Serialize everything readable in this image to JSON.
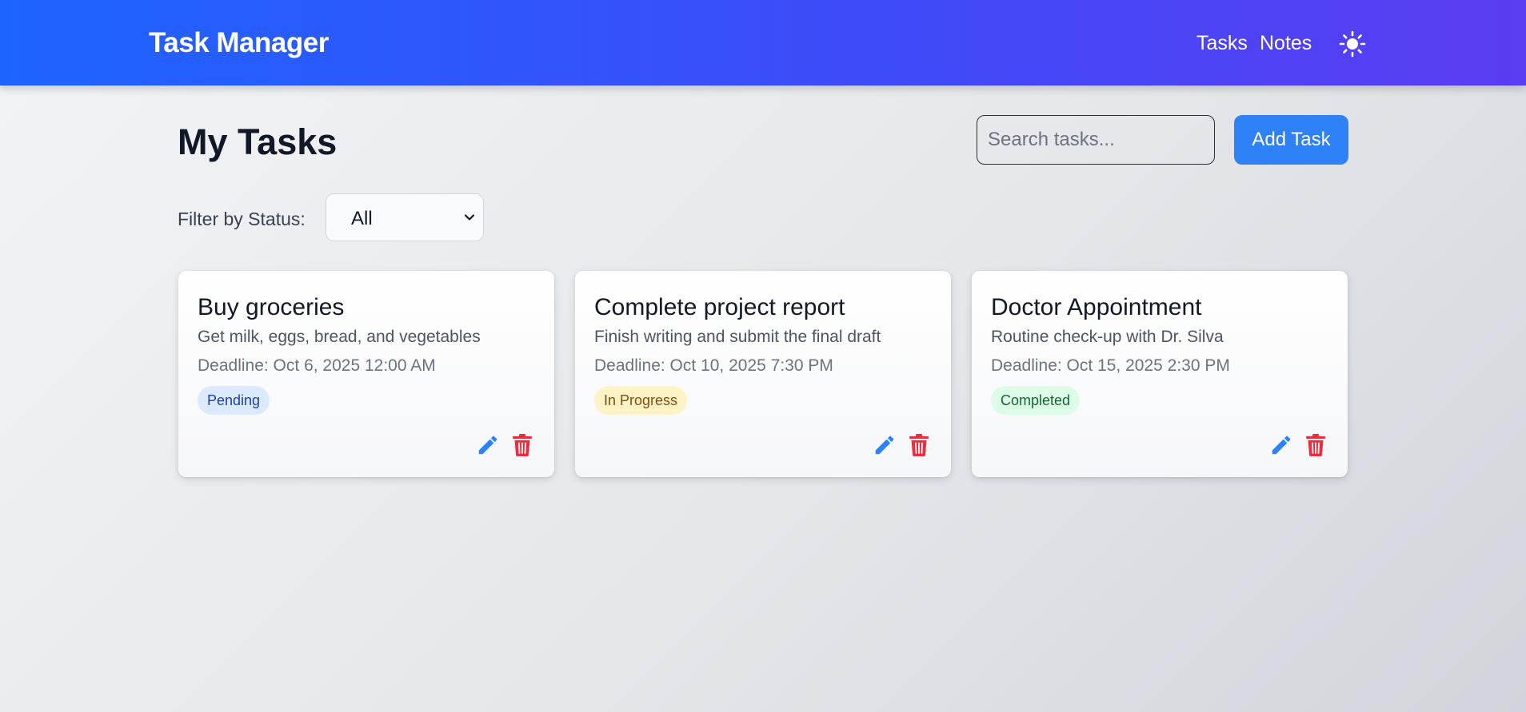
{
  "navbar": {
    "brand": "Task Manager",
    "links": [
      "Tasks",
      "Notes"
    ],
    "theme_icon": "sun-icon"
  },
  "main": {
    "title": "My Tasks",
    "search": {
      "placeholder": "Search tasks...",
      "value": ""
    },
    "add_button": "Add Task",
    "filter": {
      "label": "Filter by Status:",
      "selected": "All"
    }
  },
  "tasks": [
    {
      "title": "Buy groceries",
      "description": "Get milk, eggs, bread, and vegetables",
      "deadline": "Deadline: Oct 6, 2025 12:00 AM",
      "status": "Pending",
      "status_bg": "#dbeafe",
      "status_color": "#1e40af"
    },
    {
      "title": "Complete project report",
      "description": "Finish writing and submit the final draft",
      "deadline": "Deadline: Oct 10, 2025 7:30 PM",
      "status": "In Progress",
      "status_bg": "#fef3c7",
      "status_color": "#854d0e"
    },
    {
      "title": "Doctor Appointment",
      "description": "Routine check-up with Dr. Silva",
      "deadline": "Deadline: Oct 15, 2025 2:30 PM",
      "status": "Completed",
      "status_bg": "#dcfce7",
      "status_color": "#166534"
    }
  ],
  "colors": {
    "accent": "#2f81f7",
    "edit_icon": "#2f81f7",
    "delete_icon": "#ef2b3c",
    "nav_gradient_start": "#1d64ff",
    "nav_gradient_end": "#5a3cf2"
  },
  "icons": {
    "edit": "pencil-icon",
    "delete": "trash-icon"
  }
}
